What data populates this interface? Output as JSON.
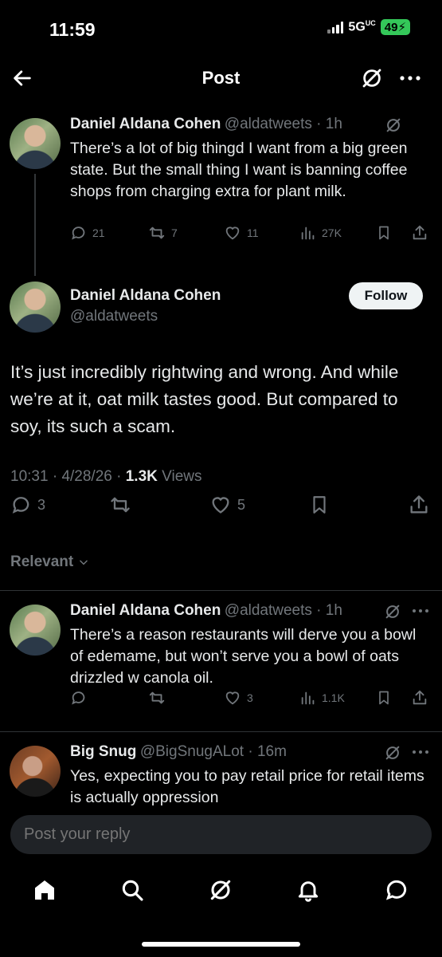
{
  "status_bar": {
    "time": "11:59",
    "network": "5G",
    "network_sup": "UC",
    "battery": "49"
  },
  "header": {
    "title": "Post"
  },
  "parent_tweet": {
    "name": "Daniel Aldana Cohen",
    "handle": "@aldatweets",
    "time": "1h",
    "text": "There’s a lot of big thingd I want from a big green state. But the small thing I want is banning coffee shops from charging extra for plant milk.",
    "replies": "21",
    "reposts": "7",
    "likes": "11",
    "views": "27K"
  },
  "main_tweet": {
    "name": "Daniel Aldana Cohen",
    "handle": "@aldatweets",
    "follow_label": "Follow",
    "text": "It’s just incredibly rightwing and wrong. And while we’re at it, oat milk tastes good. But compared to soy, its such a scam.",
    "time": "10:31",
    "date": "4/28/26",
    "views_count": "1.3K",
    "views_label": "Views",
    "replies": "3",
    "likes": "5"
  },
  "sort": {
    "label": "Relevant"
  },
  "replies": [
    {
      "name": "Daniel Aldana Cohen",
      "handle": "@aldatweets",
      "time": "1h",
      "text": "There’s a reason restaurants will derve you a bowl of edemame, but won’t serve you a bowl of oats drizzled w canola oil.",
      "likes": "3",
      "views": "1.1K"
    },
    {
      "name": "Big Snug",
      "handle": "@BigSnugALot",
      "time": "16m",
      "text": "Yes, expecting you to pay retail price for retail items is actually oppression"
    }
  ],
  "reply_bar": {
    "placeholder": "Post your reply"
  },
  "icons": [
    "back-arrow-icon",
    "grok-icon",
    "more-icon",
    "reply-icon",
    "repost-icon",
    "like-icon",
    "views-icon",
    "bookmark-icon",
    "share-icon",
    "home-icon",
    "search-icon",
    "bell-icon",
    "messages-icon"
  ]
}
